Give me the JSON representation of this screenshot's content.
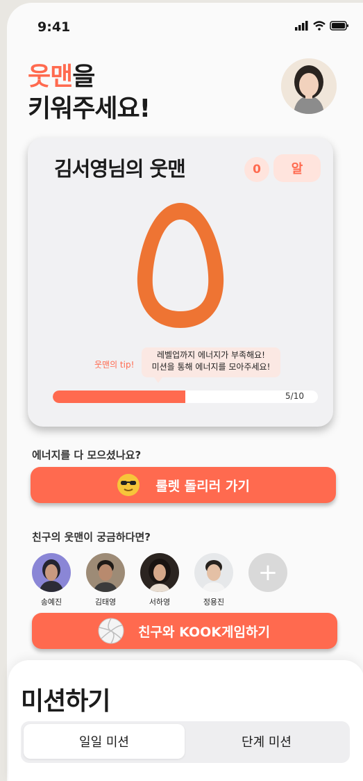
{
  "status": {
    "time": "9:41"
  },
  "hero": {
    "accent": "웃맨",
    "line1_rest": "을",
    "line2": "키워주세요!"
  },
  "card": {
    "title": "김서영님의 웃맨",
    "level_count": "0",
    "stage": "알",
    "tip_label": "웃맨의 tip!",
    "tip_line1": "레벨업까지 에너지가 부족해요!",
    "tip_line2": "미션을 통해 에너지를 모아주세요!",
    "progress_text": "5/10",
    "progress_fraction": 0.5
  },
  "energy": {
    "question": "에너지를 다 모으셨나요?",
    "button": "룰렛 돌리러 가기"
  },
  "friends": {
    "question": "친구의 웃맨이 궁금하다면?",
    "list": [
      {
        "name": "송예진"
      },
      {
        "name": "김태영"
      },
      {
        "name": "서하영"
      },
      {
        "name": "정용진"
      }
    ],
    "button": "친구와 KOOK게임하기"
  },
  "mission": {
    "title": "미션하기",
    "tabs": [
      {
        "label": "일일 미션"
      },
      {
        "label": "단계 미션"
      }
    ]
  },
  "colors": {
    "accent": "#ff6a4f",
    "egg": "#ee7433"
  }
}
